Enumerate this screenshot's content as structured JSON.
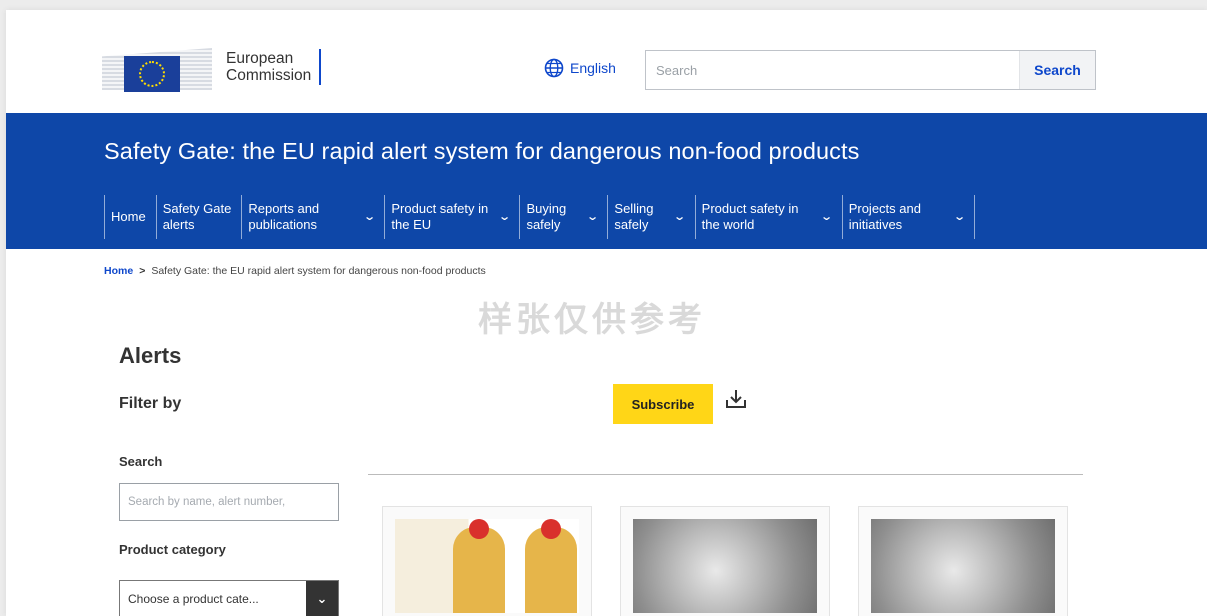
{
  "header": {
    "logo_line1": "European",
    "logo_line2": "Commission",
    "language": "English",
    "search_placeholder": "Search",
    "search_button": "Search"
  },
  "band": {
    "site_title": "Safety Gate: the EU rapid alert system for dangerous non-food products",
    "nav": [
      {
        "line1": "Home",
        "line2": ""
      },
      {
        "line1": "Safety Gate",
        "line2": "alerts"
      },
      {
        "line1": "Reports and",
        "line2": "publications"
      },
      {
        "line1": "Product safety in",
        "line2": "the EU"
      },
      {
        "line1": "Buying",
        "line2": "safely"
      },
      {
        "line1": "Selling",
        "line2": "safely"
      },
      {
        "line1": "Product safety in",
        "line2": "the world"
      },
      {
        "line1": "Projects and",
        "line2": "initiatives"
      }
    ]
  },
  "breadcrumb": {
    "home": "Home",
    "separator": ">",
    "current": "Safety Gate: the EU rapid alert system for dangerous non-food products"
  },
  "watermark": "样张仅供参考",
  "filters": {
    "heading": "Alerts",
    "filter_by": "Filter by",
    "search_label": "Search",
    "search_placeholder": "Search by name, alert number,",
    "category_label": "Product category",
    "category_value": "Choose a product cate..."
  },
  "main": {
    "subscribe": "Subscribe"
  },
  "colors": {
    "brand_blue": "#0e47a8",
    "link_blue": "#0e47cb",
    "subscribe_yellow": "#ffd617"
  },
  "icons": [
    "eu-flag-icon",
    "globe-icon",
    "chevron-down-icon",
    "download-icon"
  ]
}
